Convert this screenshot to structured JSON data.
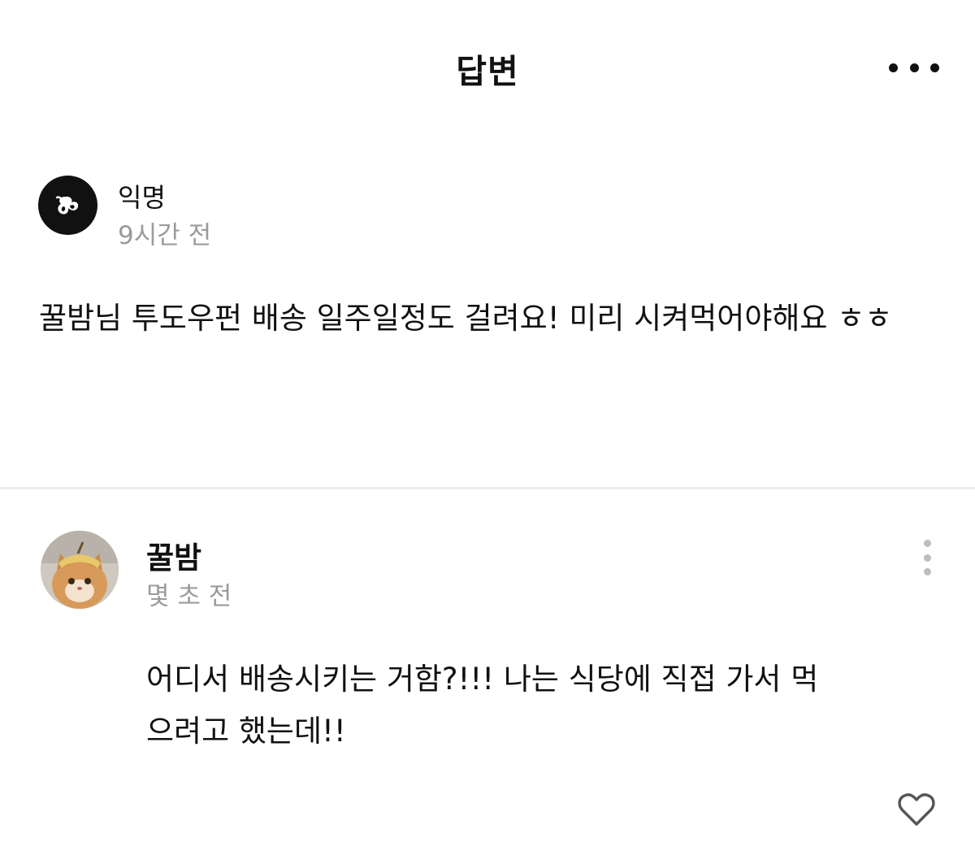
{
  "header": {
    "title": "답변",
    "more_icon": "more-horizontal-icon"
  },
  "post": {
    "author": "익명",
    "time": "9시간 전",
    "body": "꿀밤님 투도우펀 배송 일주일정도 걸려요! 미리 시켜먹어야해요 ㅎㅎ",
    "avatar_icon": "anonymous-logo-icon"
  },
  "reply": {
    "author": "꿀밤",
    "time": "몇 초 전",
    "body": "어디서 배송시키는 거함?!!! 나는 식당에 직접 가서 먹으려고 했는데!!",
    "avatar": "cat-photo-avatar",
    "more_icon": "more-vertical-icon",
    "like_icon": "heart-outline-icon"
  },
  "colors": {
    "text": "#111111",
    "muted": "#9b9b9b",
    "divider": "#ececec",
    "kebab": "#bdbdbd"
  }
}
